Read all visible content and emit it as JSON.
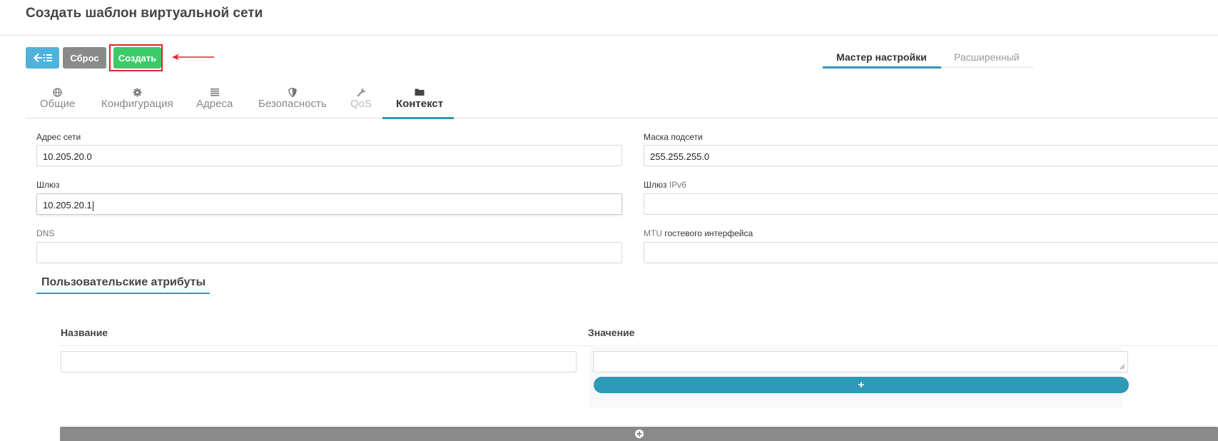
{
  "page": {
    "title": "Создать шаблон виртуальной сети"
  },
  "toolbar": {
    "back_icon": "arrow-left-list-icon",
    "reset_label": "Сброс",
    "create_label": "Создать",
    "highlight_color": "#e0242b"
  },
  "mode_tabs": [
    {
      "label": "Мастер настройки",
      "active": true
    },
    {
      "label": "Расширенный",
      "active": false
    }
  ],
  "tabs": [
    {
      "label": "Общие",
      "icon": "globe-icon"
    },
    {
      "label": "Конфигурация",
      "icon": "gear-icon"
    },
    {
      "label": "Адреса",
      "icon": "list-icon"
    },
    {
      "label": "Безопасность",
      "icon": "shield-icon"
    },
    {
      "label": "QoS",
      "icon": "wrench-icon",
      "disabled": true
    },
    {
      "label": "Контекст",
      "icon": "folder-icon",
      "active": true
    }
  ],
  "form": {
    "network_address": {
      "label": "Адрес сети",
      "value": "10.205.20.0"
    },
    "subnet_mask": {
      "label": "Маска подсети",
      "value": "255.255.255.0"
    },
    "gateway": {
      "label": "Шлюз",
      "value": "10.205.20.1"
    },
    "gateway_ipv6": {
      "label_main": "Шлюз",
      "label_light": "IPv6",
      "value": ""
    },
    "dns": {
      "label": "DNS",
      "value": ""
    },
    "mtu": {
      "label_light": "MTU",
      "label_main": "гостевого интерфейса",
      "value": ""
    }
  },
  "custom_attributes": {
    "title": "Пользовательские атрибуты",
    "name_header": "Название",
    "value_header": "Значение",
    "add_row_label": "+",
    "name_value": "",
    "value_value": ""
  },
  "colors": {
    "accent": "#2e9ab8",
    "back_button": "#4fb3d9",
    "reset_button": "#8a8a8a",
    "create_button": "#3dcb6a"
  }
}
